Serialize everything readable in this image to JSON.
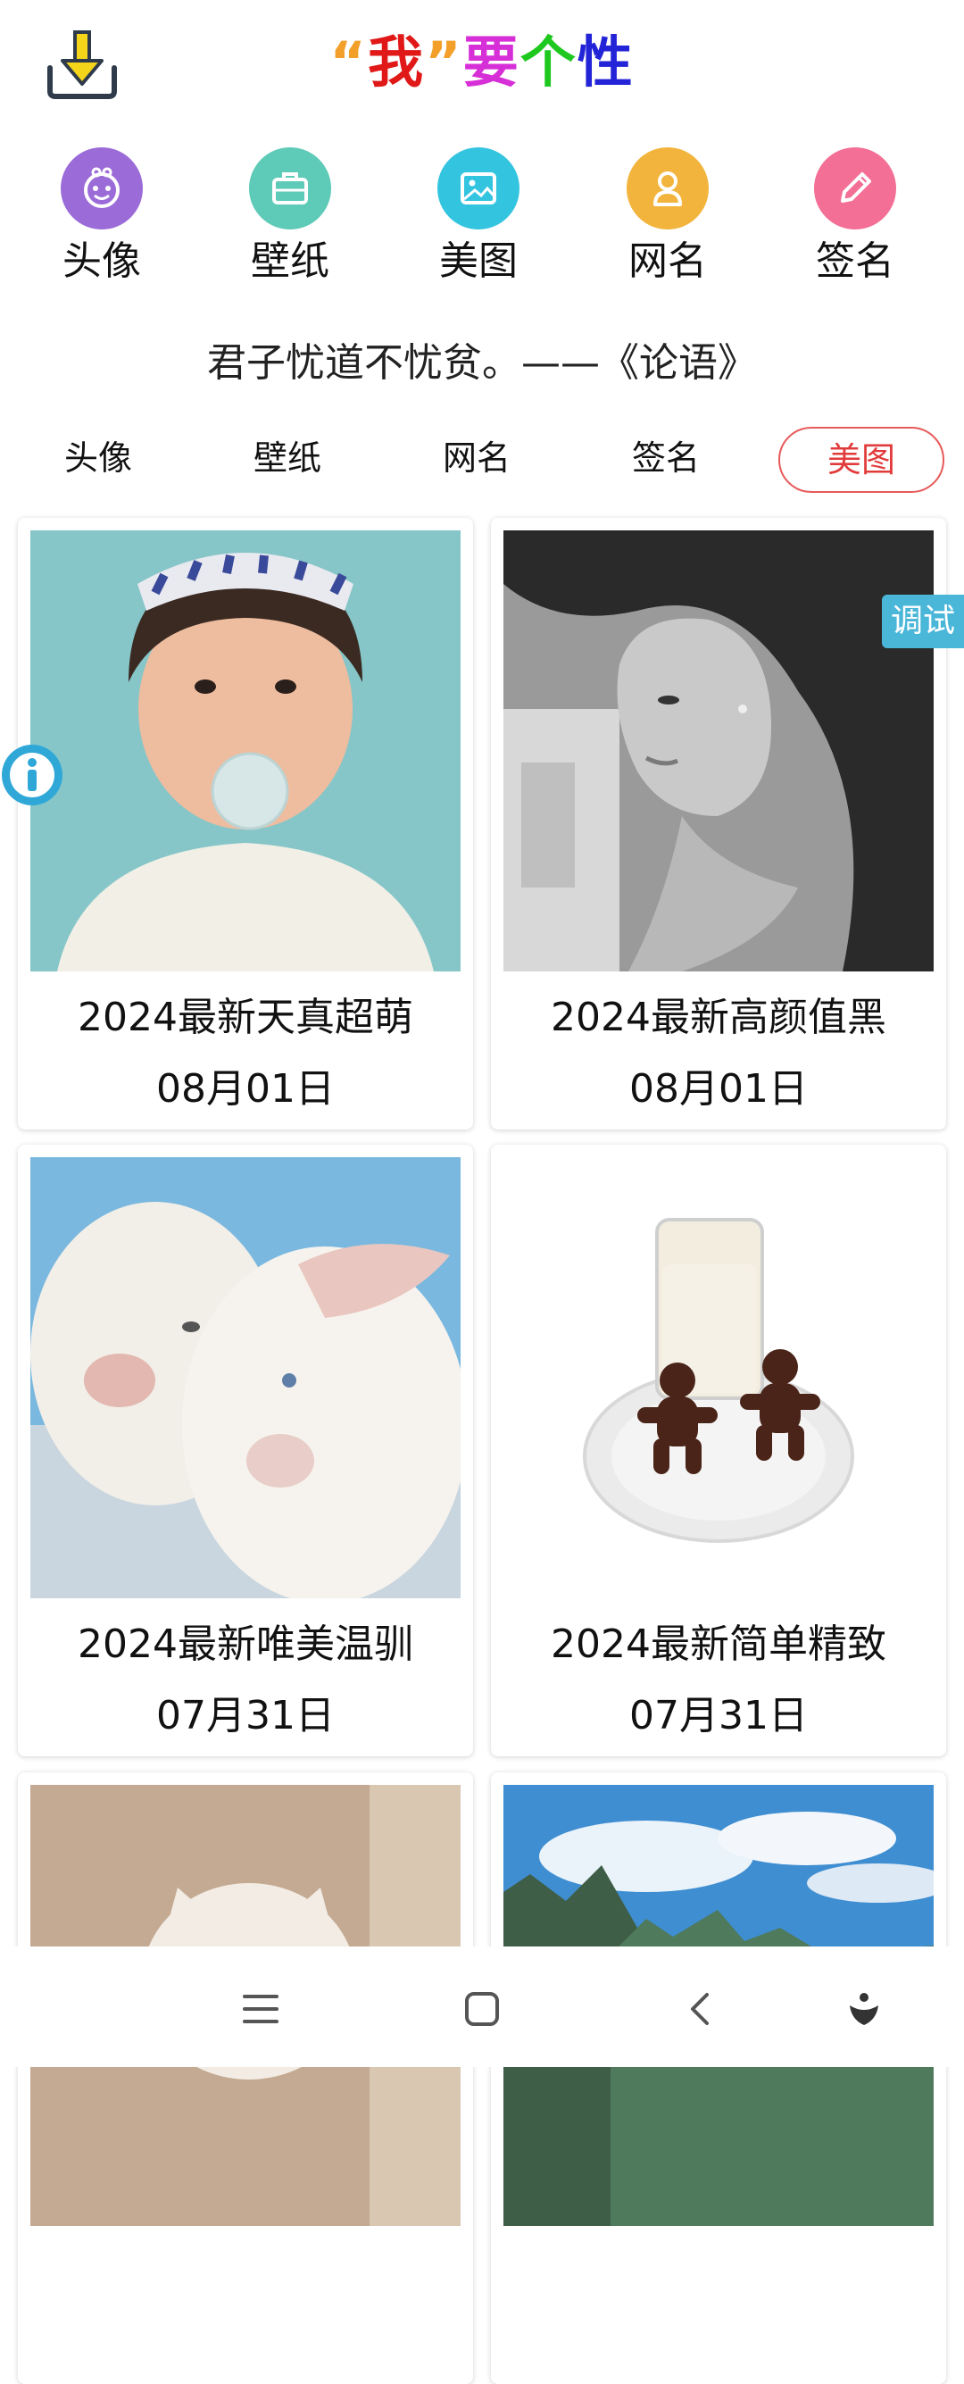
{
  "header": {
    "title_parts": [
      {
        "text": "“",
        "color": "#f2a02a"
      },
      {
        "text": "我",
        "color": "#e01818"
      },
      {
        "text": "”",
        "color": "#f2a02a"
      },
      {
        "text": "要",
        "color": "#d72fd7"
      },
      {
        "text": "个",
        "color": "#1fc81f"
      },
      {
        "text": "性",
        "color": "#2323d8"
      }
    ],
    "download_icon": "download-icon"
  },
  "categories": [
    {
      "label": "头像",
      "icon": "baby-face-icon",
      "color": "#9b6bd8"
    },
    {
      "label": "壁纸",
      "icon": "briefcase-icon",
      "color": "#5ecab8"
    },
    {
      "label": "美图",
      "icon": "image-icon",
      "color": "#33c4e0"
    },
    {
      "label": "网名",
      "icon": "user-icon",
      "color": "#f2b43c"
    },
    {
      "label": "签名",
      "icon": "pencil-icon",
      "color": "#f36f95"
    }
  ],
  "quote": "君子忧道不忧贫。——《论语》",
  "tabs": [
    {
      "label": "头像"
    },
    {
      "label": "壁纸"
    },
    {
      "label": "网名"
    },
    {
      "label": "签名"
    },
    {
      "label": "美图",
      "active": true
    }
  ],
  "cards": [
    {
      "title": "2024最新天真超萌",
      "date": "08月01日",
      "image": "child-bubblegum-photo"
    },
    {
      "title": "2024最新高颜值黑",
      "date": "08月01日",
      "image": "bw-woman-portrait"
    },
    {
      "title": "2024最新唯美温驯",
      "date": "07月31日",
      "image": "white-goats-photo"
    },
    {
      "title": "2024最新简单精致",
      "date": "07月31日",
      "image": "milk-gingerbread-photo"
    },
    {
      "title": "",
      "date": "",
      "image": "white-cat-photo"
    },
    {
      "title": "",
      "date": "",
      "image": "mountain-sky-photo"
    }
  ],
  "floating": {
    "debug_label": "调试",
    "info_icon": "info-icon"
  },
  "navbar": {
    "icons": [
      "menu-icon",
      "home-square-icon",
      "back-icon",
      "assistant-icon"
    ]
  },
  "colors": {
    "accent": "#e23b3b",
    "debug_bg": "#4ab7d9"
  }
}
